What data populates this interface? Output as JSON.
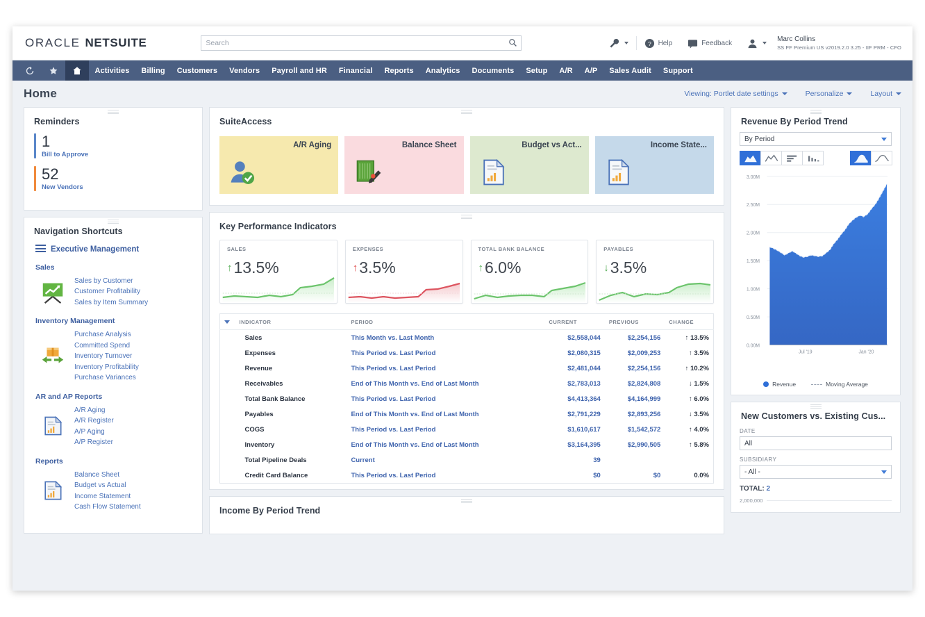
{
  "header": {
    "brand_oracle": "ORACLE",
    "brand_netsuite": "NETSUITE",
    "search_placeholder": "Search",
    "search_value": "",
    "help_label": "Help",
    "feedback_label": "Feedback",
    "user_name": "Marc Collins",
    "user_role": "SS FF Premium US v2019.2.0 3.25 - IIF PRM - CFO"
  },
  "nav": {
    "items": [
      "Activities",
      "Billing",
      "Customers",
      "Vendors",
      "Payroll and HR",
      "Financial",
      "Reports",
      "Analytics",
      "Documents",
      "Setup",
      "A/R",
      "A/P",
      "Sales Audit",
      "Support"
    ]
  },
  "page": {
    "title": "Home",
    "viewing_label": "Viewing: Portlet date settings",
    "personalize_label": "Personalize",
    "layout_label": "Layout"
  },
  "reminders": {
    "title": "Reminders",
    "items": [
      {
        "count": "1",
        "label": "Bill to Approve",
        "color": "#5b87c9"
      },
      {
        "count": "52",
        "label": "New Vendors",
        "color": "#f08a3c"
      }
    ]
  },
  "navigation_shortcuts": {
    "title": "Navigation Shortcuts",
    "executive_label": "Executive Management",
    "groups": [
      {
        "title": "Sales",
        "icon": "sales-chart-icon",
        "links": [
          "Sales by Customer",
          "Customer Profitability",
          "Sales by Item Summary"
        ]
      },
      {
        "title": "Inventory Management",
        "icon": "inventory-box-icon",
        "links": [
          "Purchase Analysis",
          "Committed Spend",
          "Inventory Turnover",
          "Inventory Profitability",
          "Purchase Variances"
        ]
      },
      {
        "title": "AR and AP Reports",
        "icon": "report-doc-icon",
        "links": [
          "A/R Aging",
          "A/R Register",
          "A/P Aging",
          "A/P Register"
        ]
      },
      {
        "title": "Reports",
        "icon": "report-doc-icon",
        "links": [
          "Balance Sheet",
          "Budget vs Actual",
          "Income Statement",
          "Cash Flow Statement"
        ]
      }
    ]
  },
  "suiteaccess": {
    "title": "SuiteAccess",
    "tiles": [
      {
        "label": "A/R Aging",
        "bg": "#f6e9ae",
        "icon": "customer-check-icon"
      },
      {
        "label": "Balance Sheet",
        "bg": "#fadbdf",
        "icon": "ledger-pencil-icon"
      },
      {
        "label": "Budget vs Act...",
        "bg": "#dde9cf",
        "icon": "report-chart-icon"
      },
      {
        "label": "Income State...",
        "bg": "#c5d9ea",
        "icon": "report-chart-icon"
      }
    ]
  },
  "kpi": {
    "title": "Key Performance Indicators",
    "cards": [
      {
        "name": "SALES",
        "value": "13.5%",
        "direction": "up",
        "color": "#5fbf5f"
      },
      {
        "name": "EXPENSES",
        "value": "3.5%",
        "direction": "up",
        "color": "#e05660"
      },
      {
        "name": "TOTAL BANK BALANCE",
        "value": "6.0%",
        "direction": "up",
        "color": "#5fbf5f"
      },
      {
        "name": "PAYABLES",
        "value": "3.5%",
        "direction": "down",
        "color": "#5fbf5f"
      }
    ],
    "columns": [
      "INDICATOR",
      "PERIOD",
      "CURRENT",
      "PREVIOUS",
      "CHANGE"
    ],
    "rows": [
      {
        "indicator": "Sales",
        "period": "This Month vs. Last Month",
        "current": "$2,558,044",
        "previous": "$2,254,156",
        "change": "13.5%",
        "direction": "up"
      },
      {
        "indicator": "Expenses",
        "period": "This Period vs. Last Period",
        "current": "$2,080,315",
        "previous": "$2,009,253",
        "change": "3.5%",
        "direction": "up-bad"
      },
      {
        "indicator": "Revenue",
        "period": "This Period vs. Last Period",
        "current": "$2,481,044",
        "previous": "$2,254,156",
        "change": "10.2%",
        "direction": "up"
      },
      {
        "indicator": "Receivables",
        "period": "End of This Month vs. End of Last Month",
        "current": "$2,783,013",
        "previous": "$2,824,808",
        "change": "1.5%",
        "direction": "down-bad"
      },
      {
        "indicator": "Total Bank Balance",
        "period": "This Period vs. Last Period",
        "current": "$4,413,364",
        "previous": "$4,164,999",
        "change": "6.0%",
        "direction": "up"
      },
      {
        "indicator": "Payables",
        "period": "End of This Month vs. End of Last Month",
        "current": "$2,791,229",
        "previous": "$2,893,256",
        "change": "3.5%",
        "direction": "down"
      },
      {
        "indicator": "COGS",
        "period": "This Period vs. Last Period",
        "current": "$1,610,617",
        "previous": "$1,542,572",
        "change": "4.0%",
        "direction": "up-bad"
      },
      {
        "indicator": "Inventory",
        "period": "End of This Month vs. End of Last Month",
        "current": "$3,164,395",
        "previous": "$2,990,505",
        "change": "5.8%",
        "direction": "up"
      },
      {
        "indicator": "Total Pipeline Deals",
        "period": "Current",
        "current": "39",
        "previous": "",
        "change": "",
        "direction": "none"
      },
      {
        "indicator": "Credit Card Balance",
        "period": "This Period vs. Last Period",
        "current": "$0",
        "previous": "$0",
        "change": "0.0%",
        "direction": "flat"
      }
    ]
  },
  "income_trend": {
    "title": "Income By Period Trend"
  },
  "revenue_trend": {
    "title": "Revenue By Period Trend",
    "select_value": "By Period",
    "legend": [
      "Revenue",
      "Moving Average"
    ]
  },
  "new_customers": {
    "title": "New Customers vs. Existing Cus...",
    "date_label": "DATE",
    "date_value": "All",
    "subsidiary_label": "SUBSIDIARY",
    "subsidiary_value": "- All -",
    "total_label": "TOTAL:",
    "total_value": "2",
    "axis_top": "2,000,000"
  },
  "chart_data": {
    "type": "area",
    "title": "Revenue By Period Trend",
    "xlabel": "",
    "ylabel": "",
    "ylim": [
      0,
      3000000
    ],
    "ytick_labels": [
      "0.00M",
      "0.50M",
      "1.00M",
      "1.50M",
      "2.00M",
      "2.50M",
      "3.00M"
    ],
    "ytick_values": [
      0,
      500000,
      1000000,
      1500000,
      2000000,
      2500000,
      3000000
    ],
    "xtick_labels": [
      "Jul '19",
      "Jan '20"
    ],
    "grid": true,
    "legend_position": "bottom",
    "series": [
      {
        "name": "Revenue",
        "values": [
          1740000,
          1725000,
          1700000,
          1660000,
          1610000,
          1640000,
          1680000,
          1650000,
          1600000,
          1575000,
          1590000,
          1610000,
          1600000,
          1585000,
          1600000,
          1640000,
          1700000,
          1790000,
          1880000,
          1960000,
          2050000,
          2150000,
          2230000,
          2280000,
          2320000,
          2290000,
          2350000,
          2430000,
          2520000,
          2620000,
          2760000,
          2900000
        ]
      },
      {
        "name": "Moving Average",
        "values": [
          1730000,
          1715000,
          1690000,
          1660000,
          1635000,
          1645000,
          1655000,
          1640000,
          1610000,
          1590000,
          1592000,
          1600000,
          1598000,
          1592000,
          1608000,
          1645000,
          1700000,
          1780000,
          1870000,
          1955000,
          2045000,
          2140000,
          2220000,
          2270000,
          2305000,
          2300000,
          2345000,
          2420000,
          2510000,
          2615000,
          2750000,
          2880000
        ]
      }
    ]
  }
}
